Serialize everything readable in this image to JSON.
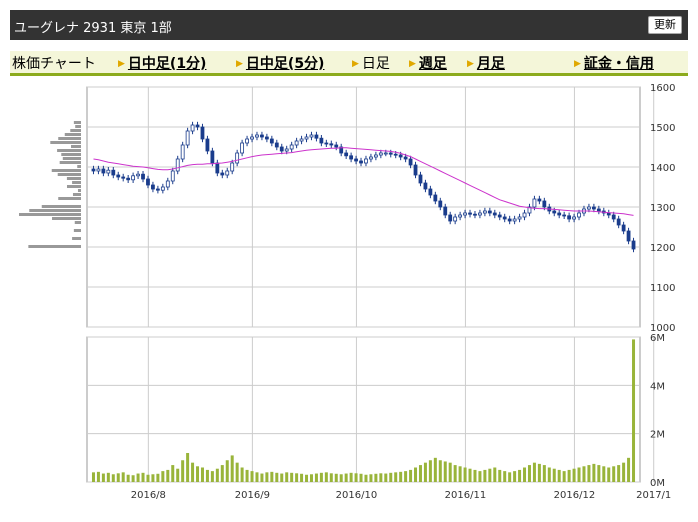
{
  "header": {
    "title": "ユーグレナ 2931 東京 1部",
    "refresh_label": "更新"
  },
  "tabs": [
    {
      "label": "株価チャート",
      "link": false,
      "arrow": false
    },
    {
      "label": "日中足(1分)",
      "link": true,
      "arrow": true
    },
    {
      "label": "日中足(5分)",
      "link": true,
      "arrow": true
    },
    {
      "label": "日足",
      "link": false,
      "arrow": true
    },
    {
      "label": "週足",
      "link": true,
      "arrow": true
    },
    {
      "label": "月足",
      "link": true,
      "arrow": true
    },
    {
      "label": "証金・信用",
      "link": true,
      "arrow": true
    }
  ],
  "chart_data": {
    "type": "candlestick",
    "price_axis": {
      "ylim": [
        1000,
        1600
      ],
      "ticks": [
        "1600",
        "1500",
        "1400",
        "1300",
        "1200",
        "1100",
        "1000"
      ]
    },
    "volume_axis": {
      "ylim": [
        0,
        6
      ],
      "unit": "M",
      "ticks": [
        "6M",
        "4M",
        "2M",
        "0M"
      ]
    },
    "x_labels": [
      "2016/8",
      "2016/9",
      "2016/10",
      "2016/11",
      "2016/12",
      "2017/1"
    ],
    "grid": true,
    "colors": {
      "up": "#ffffff",
      "down": "#1a3c8c",
      "candle_edge": "#1a3c8c",
      "ma": "#cc33cc",
      "volume": "#99b43a",
      "profile": "#999999",
      "grid": "#cccccc"
    },
    "closes": [
      1390,
      1395,
      1385,
      1392,
      1380,
      1375,
      1372,
      1368,
      1378,
      1382,
      1370,
      1355,
      1345,
      1342,
      1350,
      1365,
      1390,
      1420,
      1455,
      1490,
      1505,
      1500,
      1470,
      1440,
      1410,
      1385,
      1380,
      1390,
      1410,
      1435,
      1460,
      1470,
      1475,
      1480,
      1475,
      1470,
      1460,
      1450,
      1440,
      1445,
      1455,
      1465,
      1470,
      1475,
      1480,
      1472,
      1460,
      1458,
      1455,
      1450,
      1435,
      1428,
      1420,
      1415,
      1410,
      1420,
      1425,
      1430,
      1435,
      1435,
      1432,
      1430,
      1425,
      1420,
      1405,
      1380,
      1360,
      1345,
      1330,
      1315,
      1300,
      1280,
      1265,
      1275,
      1280,
      1285,
      1282,
      1280,
      1285,
      1290,
      1285,
      1280,
      1275,
      1270,
      1265,
      1270,
      1275,
      1285,
      1300,
      1320,
      1315,
      1300,
      1290,
      1285,
      1280,
      1278,
      1270,
      1275,
      1285,
      1295,
      1300,
      1295,
      1290,
      1285,
      1280,
      1270,
      1255,
      1240,
      1215,
      1195
    ],
    "ma": [
      1420,
      1418,
      1415,
      1412,
      1410,
      1408,
      1406,
      1404,
      1402,
      1401,
      1400,
      1398,
      1396,
      1394,
      1393,
      1393,
      1395,
      1398,
      1401,
      1404,
      1406,
      1407,
      1407,
      1408,
      1408,
      1409,
      1410,
      1412,
      1414,
      1417,
      1420,
      1423,
      1426,
      1428,
      1430,
      1431,
      1432,
      1433,
      1434,
      1435,
      1436,
      1438,
      1440,
      1442,
      1443,
      1444,
      1445,
      1446,
      1447,
      1447,
      1448,
      1448,
      1447,
      1446,
      1445,
      1444,
      1443,
      1442,
      1441,
      1440,
      1439,
      1437,
      1434,
      1430,
      1426,
      1420,
      1414,
      1408,
      1402,
      1396,
      1390,
      1384,
      1378,
      1372,
      1366,
      1360,
      1354,
      1348,
      1342,
      1336,
      1330,
      1324,
      1318,
      1314,
      1310,
      1306,
      1302,
      1300,
      1298,
      1297,
      1296,
      1296,
      1295,
      1294,
      1293,
      1292,
      1291,
      1290,
      1290,
      1290,
      1290,
      1289,
      1288,
      1287,
      1286,
      1285,
      1284,
      1283,
      1281,
      1279
    ],
    "volumes": [
      0.4,
      0.42,
      0.35,
      0.38,
      0.32,
      0.36,
      0.4,
      0.3,
      0.28,
      0.35,
      0.38,
      0.3,
      0.32,
      0.34,
      0.45,
      0.5,
      0.7,
      0.55,
      0.9,
      1.2,
      0.8,
      0.65,
      0.6,
      0.5,
      0.45,
      0.55,
      0.7,
      0.9,
      1.1,
      0.8,
      0.6,
      0.5,
      0.45,
      0.4,
      0.35,
      0.4,
      0.42,
      0.38,
      0.35,
      0.4,
      0.38,
      0.36,
      0.34,
      0.3,
      0.32,
      0.35,
      0.38,
      0.4,
      0.36,
      0.34,
      0.32,
      0.35,
      0.38,
      0.36,
      0.34,
      0.3,
      0.32,
      0.34,
      0.36,
      0.35,
      0.38,
      0.4,
      0.42,
      0.45,
      0.5,
      0.6,
      0.7,
      0.8,
      0.9,
      1.0,
      0.9,
      0.85,
      0.8,
      0.7,
      0.65,
      0.6,
      0.55,
      0.5,
      0.45,
      0.5,
      0.55,
      0.6,
      0.5,
      0.45,
      0.4,
      0.45,
      0.5,
      0.6,
      0.7,
      0.8,
      0.75,
      0.7,
      0.6,
      0.55,
      0.5,
      0.45,
      0.5,
      0.55,
      0.6,
      0.65,
      0.7,
      0.75,
      0.7,
      0.65,
      0.6,
      0.65,
      0.7,
      0.8,
      1.0,
      5.9
    ]
  }
}
